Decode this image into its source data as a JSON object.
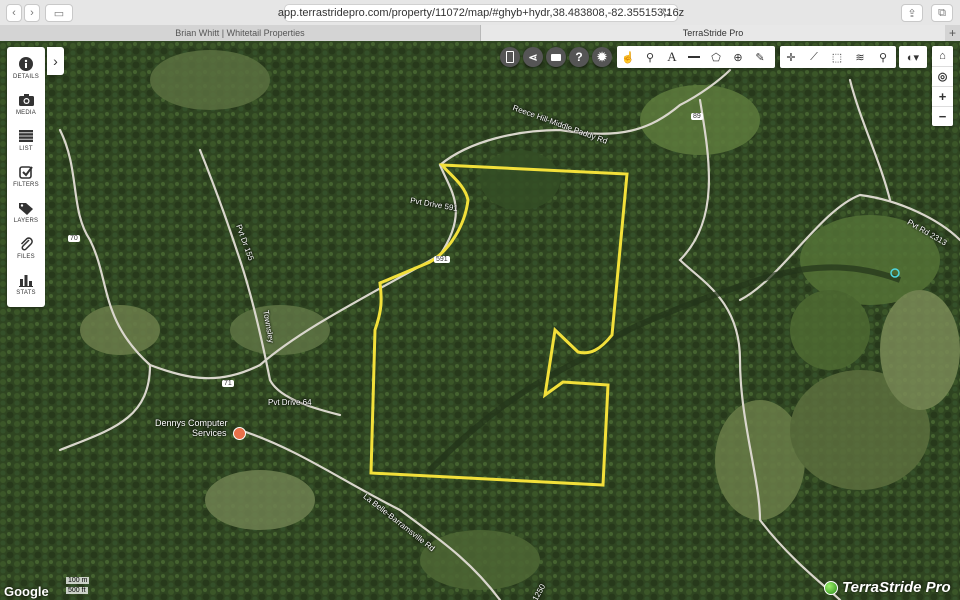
{
  "browser": {
    "url": "app.terrastridepro.com/property/11072/map/#ghyb+hydr,38.483808,-82.355153,16z",
    "tabs": [
      {
        "label": "Brian Whitt | Whitetail Properties"
      },
      {
        "label": "TerraStride Pro"
      }
    ],
    "new_tab": "+"
  },
  "sidebar": {
    "items": [
      {
        "label": "DETAILS",
        "icon": "info-icon"
      },
      {
        "label": "MEDIA",
        "icon": "camera-icon"
      },
      {
        "label": "LIST",
        "icon": "list-icon"
      },
      {
        "label": "FILTERS",
        "icon": "checkbox-icon"
      },
      {
        "label": "LAYERS",
        "icon": "tag-icon"
      },
      {
        "label": "FILES",
        "icon": "paperclip-icon"
      },
      {
        "label": "STATS",
        "icon": "bar-chart-icon"
      }
    ],
    "toggle_icon": "chevron-right-icon"
  },
  "round_buttons": [
    {
      "icon": "mobile-icon"
    },
    {
      "icon": "share-icon"
    },
    {
      "icon": "print-icon"
    },
    {
      "icon": "help-icon",
      "glyph": "?"
    },
    {
      "icon": "settings-icon"
    }
  ],
  "toolbar": {
    "draw_tools": [
      {
        "icon": "select-icon"
      },
      {
        "icon": "marker-icon"
      },
      {
        "icon": "text-icon",
        "glyph": "A"
      },
      {
        "icon": "line-icon"
      },
      {
        "icon": "polygon-icon"
      },
      {
        "icon": "target-icon"
      },
      {
        "icon": "pencil-icon"
      }
    ],
    "map_tools": [
      {
        "icon": "crosshair-icon"
      },
      {
        "icon": "ruler-icon"
      },
      {
        "icon": "measure-area-icon"
      },
      {
        "icon": "layers-icon"
      },
      {
        "icon": "search-icon"
      }
    ],
    "basemap": {
      "icon": "globe-icon"
    }
  },
  "zoom_controls": [
    {
      "icon": "home-icon"
    },
    {
      "icon": "locate-icon"
    },
    {
      "icon": "zoom-in-icon",
      "glyph": "+"
    },
    {
      "icon": "zoom-out-icon",
      "glyph": "−"
    }
  ],
  "map_labels": [
    {
      "text": "Reece Hill-Middle Paddy Rd"
    },
    {
      "text": "Pvt Drive 591"
    },
    {
      "text": "Pvt Drive 64"
    },
    {
      "text": "La Belle-Barramsville Rd"
    },
    {
      "text": "Pvt Rd 2313"
    },
    {
      "text": "Townsley"
    },
    {
      "text": "Pvt Dr 155"
    },
    {
      "text": "70"
    },
    {
      "text": "71"
    },
    {
      "text": "89"
    },
    {
      "text": "591"
    },
    {
      "text": "1250"
    }
  ],
  "poi": {
    "line1": "Dennys Computer",
    "line2": "Services"
  },
  "footer": {
    "google": "Google",
    "scale_m": "100 m",
    "scale_ft": "500 ft",
    "brand": "TerraStride Pro"
  },
  "colors": {
    "boundary": "#f2e03a",
    "poi": "#e8704a"
  }
}
